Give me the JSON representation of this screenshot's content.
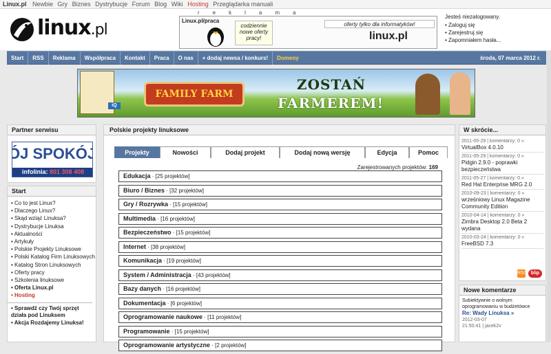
{
  "topbar": {
    "site": "Linux.pl",
    "links": [
      "Newbie",
      "Gry",
      "Biznes",
      "Dystrybucje",
      "Forum",
      "Blog",
      "Wiki",
      "Hosting",
      "Przeglądarka manuali"
    ]
  },
  "header": {
    "logo_main": "linux",
    "logo_suffix": ".pl",
    "reklama": "reklama",
    "banner_label": "Linux.pl/praca",
    "banner_bubble": "codziennie nowe oferty pracy!",
    "banner_tag": "oferty tylko dla informatyków!",
    "banner_logo": "linux.pl"
  },
  "login": {
    "greeting": "Jesteś niezalogowany.",
    "links": [
      "Zaloguj się",
      "Zarejestruj się",
      "Zapomniałem hasła..."
    ]
  },
  "nav": {
    "items": [
      "Start",
      "RSS",
      "Reklama",
      "Współpraca",
      "Kontakt",
      "Praca",
      "O nas",
      "+ dodaj newsa / konkurs!",
      "Domeny"
    ],
    "date": "środa, 07 marca 2012 r."
  },
  "bigbanner": {
    "game_title": "FAMILY FARM",
    "line1": "ZOSTAŃ",
    "line2": "FARMEREM!",
    "badge": "iQ"
  },
  "partner": {
    "heading": "Partner serwisu",
    "ad_text": "ÓJ SPOKÓJ",
    "ad_phone_label": "infolinia:",
    "ad_phone": "801 308 408"
  },
  "start": {
    "heading": "Start",
    "items": [
      "Co to jest Linux?",
      "Dlaczego Linux?",
      "Skąd wziąć Linuksa?",
      "Dystrybucje Linuksa",
      "Aktualności",
      "Artykuły",
      "Polskie Projekty Linuksowe",
      "Polski Katalog Firm Linuksowych",
      "Katalog Stron Linuksowych",
      "Oferty pracy",
      "Szkolenia linuksowe",
      "Oferta Linux.pl",
      "Hosting"
    ],
    "extra": [
      "• Sprawdź czy Twój sprzęt działa pod Linuksem",
      "• Akcja Rozdajemy Linuksa!"
    ]
  },
  "main": {
    "heading": "Polskie projekty linuksowe",
    "tabs": [
      "Projekty",
      "Nowości",
      "Dodaj projekt",
      "Dodaj nową wersję",
      "Edycja",
      "Pomoc"
    ],
    "count_label": "Zarejestrowanych projektów:",
    "count_value": "169",
    "categories": [
      {
        "name": "Edukacja",
        "count": "· [25 projektów]"
      },
      {
        "name": "Biuro / Biznes",
        "count": "· [32 projektów]"
      },
      {
        "name": "Gry / Rozrywka",
        "count": "· [15 projektów]"
      },
      {
        "name": "Multimedia",
        "count": "· [16 projektów]"
      },
      {
        "name": "Bezpieczeństwo",
        "count": "· [15 projektów]"
      },
      {
        "name": "Internet",
        "count": "· [38 projektów]"
      },
      {
        "name": "Komunikacja",
        "count": "· [19 projektów]"
      },
      {
        "name": "System / Administracja",
        "count": "· [43 projektów]"
      },
      {
        "name": "Bazy danych",
        "count": "· [16 projektów]"
      },
      {
        "name": "Dokumentacja",
        "count": "· [6 projektów]"
      },
      {
        "name": "Oprogramowanie naukowe",
        "count": "· [11 projektów]"
      },
      {
        "name": "Programowanie",
        "count": "· [15 projektów]"
      },
      {
        "name": "Oprogramowanie artystyczne",
        "count": "· [2 projektów]"
      }
    ]
  },
  "skrocie": {
    "heading": "W skrócie...",
    "items": [
      {
        "meta": "2011-05-29 | komentarzy: 0 »",
        "title": "VirtualBox 4.0.10"
      },
      {
        "meta": "2011-05-29 | komentarzy: 0 »",
        "title": "Pidgin 2.9.0 - poprawki bezpieczeństwa"
      },
      {
        "meta": "2011-05-27 | komentarzy: 0 »",
        "title": "Red Hat Enterprise MRG 2.0"
      },
      {
        "meta": "2010-09-23 | komentarzy: 0 »",
        "title": "wrześniowy Linux Magazine Community Edition"
      },
      {
        "meta": "2010-04-14 | komentarzy: 0 »",
        "title": "Zimbra Desktop 2.0 Beta 2 wydana"
      },
      {
        "meta": "2010-03-24 | komentarzy: 0 »",
        "title": "FreeBSD 7.3"
      }
    ],
    "rss": "RSS",
    "blip": "blip"
  },
  "komentarze": {
    "heading": "Nowe komentarze",
    "lead": "Subiektywnie o wolnym oprogramowaniu w budżetówce",
    "reply": "Re: Wady Linuksa »",
    "date": "2012-03-07",
    "meta": "21:50:41 | jacek2v"
  }
}
